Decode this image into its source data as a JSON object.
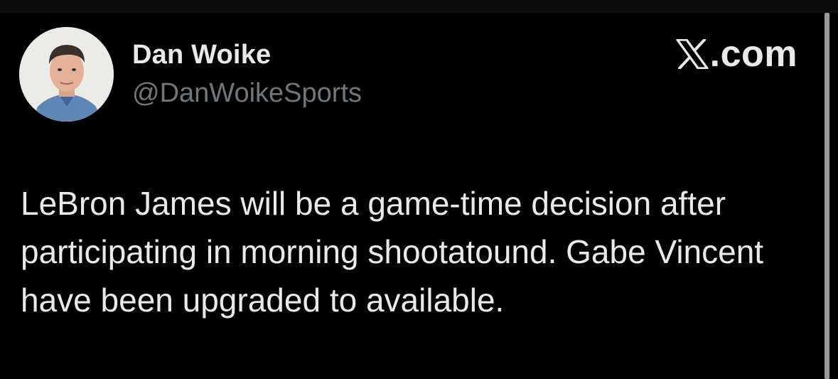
{
  "post": {
    "author": {
      "display_name": "Dan Woike",
      "handle": "@DanWoikeSports"
    },
    "brand": {
      "icon": "x-logo-icon",
      "text": ".com"
    },
    "text": "LeBron James will be a game-time decision after participating in morning shootatound. Gabe Vincent have been upgraded to available."
  },
  "colors": {
    "background": "#000000",
    "primary_text": "#e7e9ea",
    "secondary_text": "#71767b",
    "scrollbar": "#9a9a9a"
  }
}
